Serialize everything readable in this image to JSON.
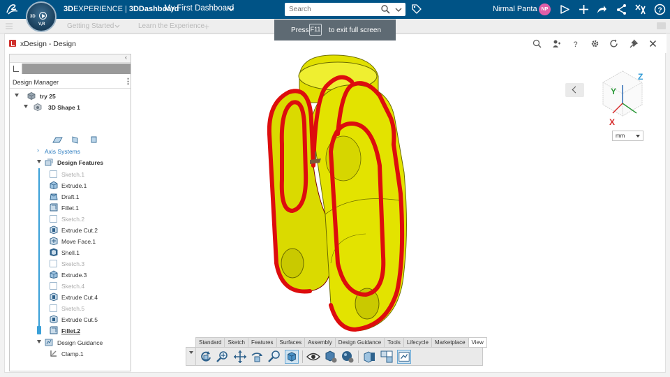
{
  "topbar": {
    "brand_bold": "3D",
    "brand_rest": "EXPERIENCE",
    "separator": "|",
    "app_bold": "3DDashboard",
    "dashboard_name": "My First Dashboard",
    "compass_label_3d": "3D",
    "compass_label_v": "V,R",
    "search_placeholder": "Search",
    "user_name": "Nirmal Panta",
    "user_initials": "NP",
    "colors": {
      "bar": "#005386",
      "avatar": "#e05fa8"
    },
    "icons": [
      "dassault-logo-icon",
      "compass-icon",
      "chevron-down-icon",
      "search-icon",
      "tag-icon",
      "share-icon",
      "plus-icon",
      "forward-icon",
      "network-icon",
      "tools-icon",
      "help-icon"
    ]
  },
  "toast": {
    "press": "Press",
    "key": "F11",
    "rest": "to exit full screen"
  },
  "tabbar": {
    "tabs": [
      "Getting Started",
      "Learn the Experience"
    ]
  },
  "widget": {
    "title": "xDesign - Design",
    "header_icons": [
      "search-icon",
      "user-icon",
      "help-icon",
      "gear-icon",
      "refresh-icon",
      "pin-icon",
      "close-icon"
    ]
  },
  "tree": {
    "panel_title": "Design Manager",
    "more": "⋮",
    "root": "try 25",
    "shape": "3D Shape 1",
    "axis_systems": "Axis Systems",
    "design_features": "Design Features",
    "features": [
      {
        "label": "Sketch.1",
        "kind": "sketch"
      },
      {
        "label": "Extrude.1",
        "kind": "solid"
      },
      {
        "label": "Draft.1",
        "kind": "solid"
      },
      {
        "label": "Fillet.1",
        "kind": "solid"
      },
      {
        "label": "Sketch.2",
        "kind": "sketch"
      },
      {
        "label": "Extrude Cut.2",
        "kind": "solid"
      },
      {
        "label": "Move Face.1",
        "kind": "solid"
      },
      {
        "label": "Shell.1",
        "kind": "solid"
      },
      {
        "label": "Sketch.3",
        "kind": "sketch"
      },
      {
        "label": "Extrude.3",
        "kind": "solid"
      },
      {
        "label": "Sketch.4",
        "kind": "sketch"
      },
      {
        "label": "Extrude Cut.4",
        "kind": "solid"
      },
      {
        "label": "Sketch.5",
        "kind": "sketch"
      },
      {
        "label": "Extrude Cut.5",
        "kind": "solid"
      },
      {
        "label": "Fillet.2",
        "kind": "current"
      }
    ],
    "design_guidance": "Design Guidance",
    "clamp": "Clamp.1"
  },
  "viewport": {
    "units": "mm",
    "axis_labels": {
      "x": "X",
      "y": "Y",
      "z": "Z"
    },
    "model_colors": {
      "body": "#e3e300",
      "edge": "#dd0d0d"
    }
  },
  "actionbar": {
    "tabs": [
      "Standard",
      "Sketch",
      "Features",
      "Surfaces",
      "Assembly",
      "Design Guidance",
      "Tools",
      "Lifecycle",
      "Marketplace",
      "View"
    ],
    "active_tab": "View",
    "tools": [
      "rotate-view-icon",
      "zoom-icon",
      "pan-icon",
      "rotate-icon",
      "zoom-area-icon",
      "fit-all-icon",
      "hide-show-icon",
      "render-style-icon",
      "appearance-icon",
      "section-icon",
      "multi-view-icon",
      "camera-icon"
    ]
  }
}
